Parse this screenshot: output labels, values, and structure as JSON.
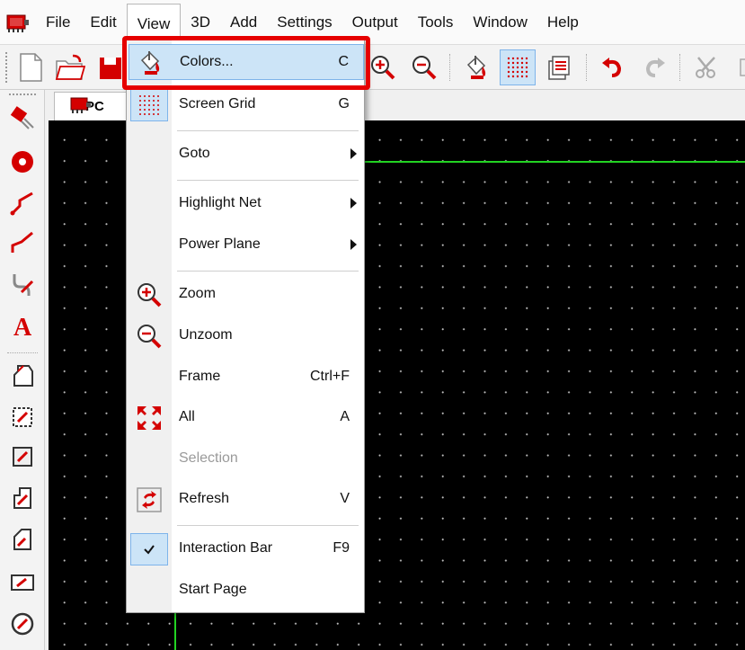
{
  "menubar": {
    "items": [
      "File",
      "Edit",
      "View",
      "3D",
      "Add",
      "Settings",
      "Output",
      "Tools",
      "Window",
      "Help"
    ],
    "active": "View"
  },
  "document_tab": {
    "title": "PC"
  },
  "view_menu": {
    "items": [
      {
        "label": "Colors...",
        "shortcut": "C",
        "icon": "paint-bucket-icon",
        "state": "highlighted"
      },
      {
        "label": "Screen Grid",
        "shortcut": "G",
        "icon": "grid-icon",
        "state": "checked"
      },
      {
        "label": "Goto",
        "shortcut": "",
        "submenu": true
      },
      {
        "label": "Highlight Net",
        "shortcut": "",
        "submenu": true
      },
      {
        "label": "Power Plane",
        "shortcut": "",
        "submenu": true
      },
      {
        "label": "Zoom",
        "shortcut": "",
        "icon": "zoom-in-icon"
      },
      {
        "label": "Unzoom",
        "shortcut": "",
        "icon": "zoom-out-icon"
      },
      {
        "label": "Frame",
        "shortcut": "Ctrl+F"
      },
      {
        "label": "All",
        "shortcut": "A",
        "icon": "zoom-all-icon"
      },
      {
        "label": "Selection",
        "shortcut": "",
        "state": "disabled"
      },
      {
        "label": "Refresh",
        "shortcut": "V",
        "icon": "refresh-icon"
      },
      {
        "label": "Interaction Bar",
        "shortcut": "F9",
        "icon": "checkmark-icon",
        "state": "checked"
      },
      {
        "label": "Start Page",
        "shortcut": ""
      }
    ]
  },
  "colors": {
    "accent_red": "#d40000",
    "highlight_box": "#e60000",
    "selection_blue": "#cce4f7",
    "trace_green": "#22d322",
    "canvas_bg": "#000000"
  }
}
